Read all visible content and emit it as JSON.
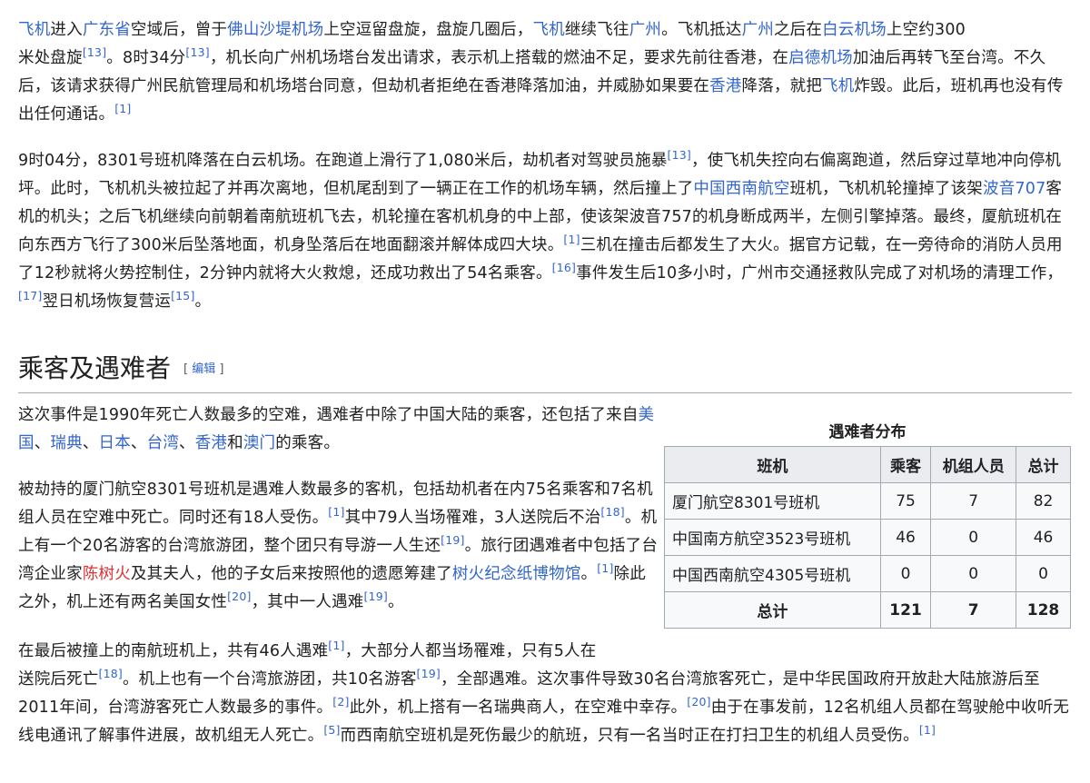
{
  "para1": {
    "line1": [
      {
        "t": "飞机",
        "l": true
      },
      {
        "t": "进入"
      },
      {
        "t": "广东省",
        "l": true
      },
      {
        "t": "空域后，曾于"
      },
      {
        "t": "佛山沙堤机场",
        "l": true
      },
      {
        "t": "上空逗留盘旋，盘旋几圈后，"
      },
      {
        "t": "飞机",
        "l": true
      },
      {
        "t": "继续飞往"
      },
      {
        "t": "广州",
        "l": true
      },
      {
        "t": "。飞机抵达"
      },
      {
        "t": "广州",
        "l": true
      },
      {
        "t": "之后在"
      },
      {
        "t": "白云机场",
        "l": true
      },
      {
        "t": "上空约300"
      }
    ],
    "rest": [
      {
        "t": "米处盘旋"
      },
      {
        "t": "[13]",
        "s": true
      },
      {
        "t": "。8时34分"
      },
      {
        "t": "[13]",
        "s": true
      },
      {
        "t": "，机长向广州机场塔台发出请求，表示机上搭载的燃油不足，要求先前往香港，在"
      },
      {
        "t": "启德机场",
        "l": true
      },
      {
        "t": "加油后再转飞至台湾。不久后，该请求获得广州民航管理局和机场塔台同意，但劫机者拒绝在香港降落加油，并威胁如果要在"
      },
      {
        "t": "香港",
        "l": true
      },
      {
        "t": "降落，就把"
      },
      {
        "t": "飞机",
        "l": true
      },
      {
        "t": "炸毁。此后，班机再也没有传出任何通话。"
      },
      {
        "t": "[1]",
        "s": true
      }
    ]
  },
  "para2": [
    {
      "t": "9时04分，8301号班机降落在白云机场。在跑道上滑行了1,080米后，劫机者对驾驶员施暴"
    },
    {
      "t": "[13]",
      "s": true
    },
    {
      "t": "，使飞机失控向右偏离跑道，然后穿过草地冲向停机坪。此时，飞机机头被拉起了并再次离地，但机尾刮到了一辆正在工作的机场车辆，然后撞上了"
    },
    {
      "t": "中国西南航空",
      "l": true
    },
    {
      "t": "班机，飞机机轮撞掉了该架"
    },
    {
      "t": "波音707",
      "l": true
    },
    {
      "t": "客机的机头；之后飞机继续向前朝着南航班机飞去，机轮撞在客机机身的中上部，使该架波音757的机身断成两半，左侧引擎掉落。最终，厦航班机在向东西方飞行了300米后坠落地面，机身坠落后在地面翻滚并解体成四大块。"
    },
    {
      "t": "[1]",
      "s": true
    },
    {
      "t": "三机在撞击后都发生了大火。据官方记载，在一旁待命的消防人员用了12秒就将火势控制住，2分钟内就将大火救熄，还成功救出了54名乘客。"
    },
    {
      "t": "[16]",
      "s": true
    },
    {
      "t": "事件发生后10多小时，广州市交通拯救队完成了对机场的清理工作，"
    },
    {
      "t": "[17]",
      "s": true
    },
    {
      "t": "翌日机场恢复营运"
    },
    {
      "t": "[15]",
      "s": true
    },
    {
      "t": "。"
    }
  ],
  "section": {
    "title": "乘客及遇难者",
    "edit_open": "[ ",
    "edit": "编辑",
    "edit_close": " ]"
  },
  "para3": [
    {
      "t": "这次事件是1990年死亡人数最多的空难，遇难者中除了中国大陆的乘客，还包括了来自"
    },
    {
      "t": "美国",
      "l": true
    },
    {
      "t": "、"
    },
    {
      "t": "瑞典",
      "l": true
    },
    {
      "t": "、"
    },
    {
      "t": "日本",
      "l": true
    },
    {
      "t": "、"
    },
    {
      "t": "台湾",
      "l": true
    },
    {
      "t": "、"
    },
    {
      "t": "香港",
      "l": true
    },
    {
      "t": "和"
    },
    {
      "t": "澳门",
      "l": true
    },
    {
      "t": "的乘客。"
    }
  ],
  "para4": [
    {
      "t": "被劫持的厦门航空8301号班机是遇难人数最多的客机，包括劫机者在内75名乘客和7名机组人员在空难中死亡。同时还有18人受伤。"
    },
    {
      "t": "[1]",
      "s": true
    },
    {
      "t": "其中79人当场罹难，3人送院后不治"
    },
    {
      "t": "[18]",
      "s": true
    },
    {
      "t": "。机上有一个20名游客的台湾旅游团，整个团只有导游一人生还"
    },
    {
      "t": "[19]",
      "s": true
    },
    {
      "t": "。旅行团遇难者中包括了台湾企业家"
    },
    {
      "t": "陈树火",
      "r": true
    },
    {
      "t": "及其夫人，他的子女后来按照他的遗愿筹建了"
    },
    {
      "t": "树火纪念纸博物馆",
      "l": true
    },
    {
      "t": "。"
    },
    {
      "t": "[1]",
      "s": true
    },
    {
      "t": "除此之外，机上还有两名美国女性"
    },
    {
      "t": "[20]",
      "s": true
    },
    {
      "t": "，其中一人遇难"
    },
    {
      "t": "[19]",
      "s": true
    },
    {
      "t": "。"
    }
  ],
  "para5": {
    "line1": [
      {
        "t": "在最后被撞上的南航班机上，共有46人遇难"
      },
      {
        "t": "[1]",
        "s": true
      },
      {
        "t": "，大部分人都当场罹难，只有5人在"
      }
    ],
    "rest": [
      {
        "t": "送院后死亡"
      },
      {
        "t": "[18]",
        "s": true
      },
      {
        "t": "。机上也有一个台湾旅游团，共10名游客"
      },
      {
        "t": "[19]",
        "s": true
      },
      {
        "t": "，全部遇难。这次事件导致30名台湾旅客死亡，是中华民国政府开放赴大陆旅游后至2011年间，台湾游客死亡人数最多的事件。"
      },
      {
        "t": "[2]",
        "s": true
      },
      {
        "t": "此外，机上搭有一名瑞典商人，在空难中幸存。"
      },
      {
        "t": "[20]",
        "s": true
      },
      {
        "t": "由于在事发前，12名机组人员都在驾驶舱中收听无线电通讯了解事件进展，故机组无人死亡。"
      },
      {
        "t": "[5]",
        "s": true
      },
      {
        "t": "而西南航空班机是死伤最少的航班，只有一名当时正在打扫卫生的机组人员受伤。"
      },
      {
        "t": "[1]",
        "s": true
      }
    ]
  },
  "table": {
    "caption": "遇难者分布",
    "headers": [
      "班机",
      "乘客",
      "机组人员",
      "总计"
    ],
    "rows": [
      [
        "厦门航空8301号班机",
        "75",
        "7",
        "82"
      ],
      [
        "中国南方航空3523号班机",
        "46",
        "0",
        "46"
      ],
      [
        "中国西南航空4305号班机",
        "0",
        "0",
        "0"
      ]
    ],
    "total": [
      "总计",
      "121",
      "7",
      "128"
    ]
  }
}
